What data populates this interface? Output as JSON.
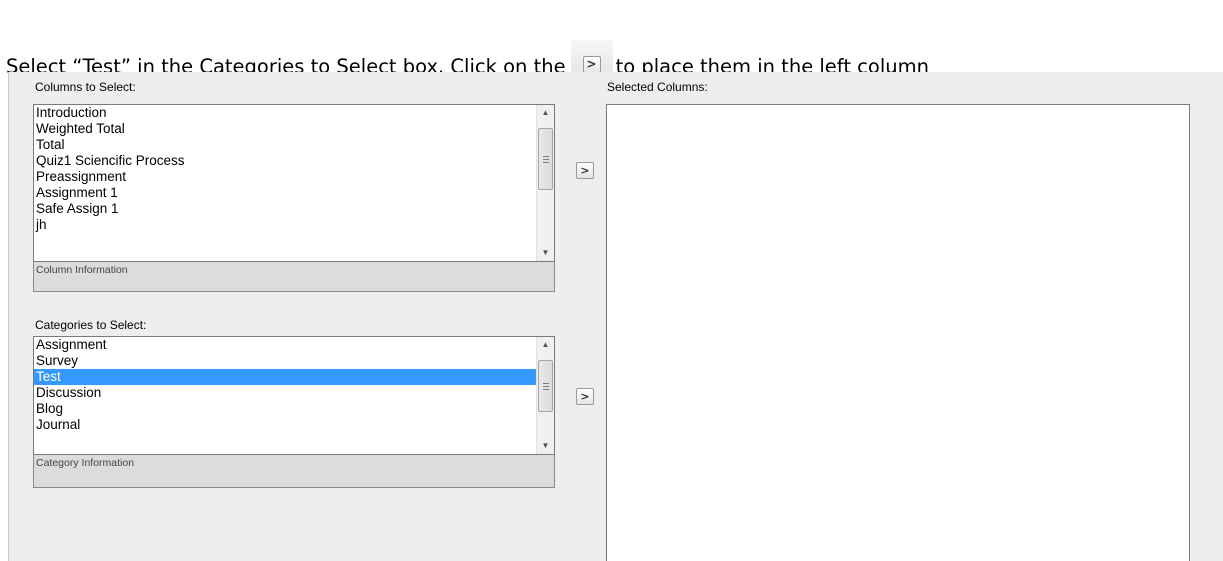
{
  "instruction": {
    "before": "Select “Test” in the Categories to Select box.  Click on the",
    "button_glyph": ">",
    "after": "to place them in the left column"
  },
  "columns": {
    "label": "Columns to Select:",
    "items": [
      "Introduction",
      "Weighted Total",
      "Total",
      "Quiz1 Sciencific Process",
      "Preassignment",
      "Assignment 1",
      "Safe Assign 1",
      "jh"
    ],
    "info": "Column Information",
    "move_glyph": ">"
  },
  "categories": {
    "label": "Categories to Select:",
    "items": [
      "Assignment",
      "Survey",
      "Test",
      "Discussion",
      "Blog",
      "Journal"
    ],
    "selected_item": "Test",
    "info": "Category Information",
    "move_glyph": ">"
  },
  "selected": {
    "label": "Selected Columns:"
  },
  "scrollbar": {
    "up_arrow": "▲",
    "down_arrow": "▼"
  },
  "colors": {
    "selection": "#3399ff",
    "panel": "#eeeeee"
  }
}
